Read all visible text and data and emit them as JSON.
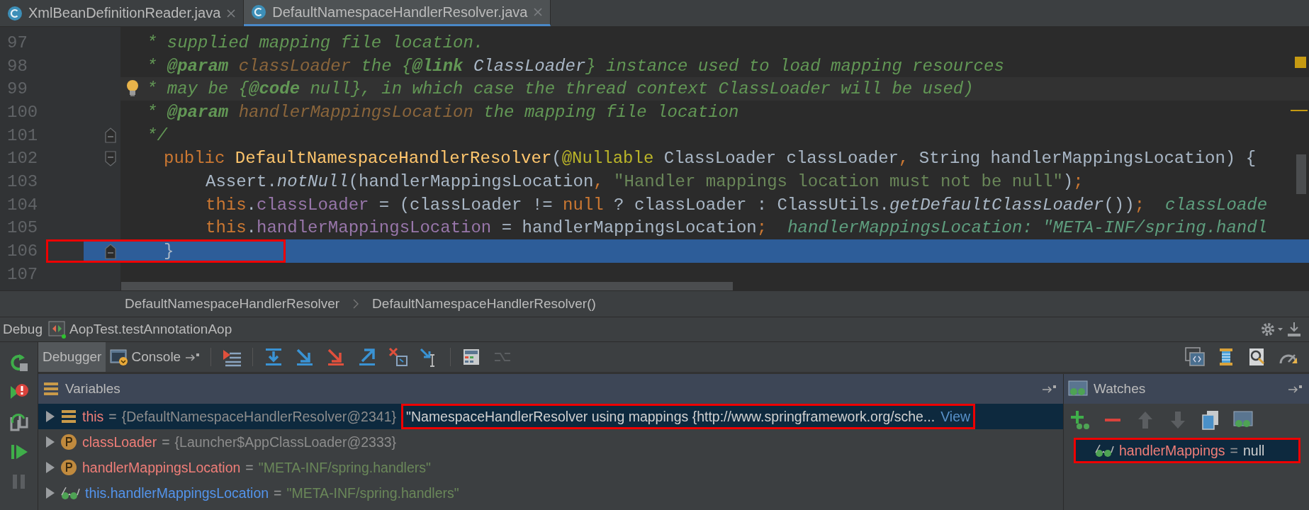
{
  "tabs": [
    {
      "label": "XmlBeanDefinitionReader.java",
      "selected": false
    },
    {
      "label": "DefaultNamespaceHandlerResolver.java",
      "selected": true
    }
  ],
  "editor": {
    "lines": [
      {
        "number": "97",
        "kind": "comment",
        "current": false,
        "execution": false,
        "annotated": false,
        "tokens": [
          {
            "t": "* supplied mapping file location.",
            "kind": "comment"
          }
        ]
      },
      {
        "number": "98",
        "kind": "comment",
        "current": false,
        "execution": false,
        "annotated": false,
        "tokens": [
          {
            "t": "* ",
            "kind": "comment"
          },
          {
            "t": "@param",
            "kind": "tag"
          },
          {
            "t": " classLoader",
            "kind": "param"
          },
          {
            "t": " the {",
            "kind": "comment"
          },
          {
            "t": "@link",
            "kind": "tag"
          },
          {
            "t": " ClassLoader",
            "kind": "link"
          },
          {
            "t": "} instance used to load mapping resources",
            "kind": "comment"
          }
        ]
      },
      {
        "number": "99",
        "kind": "comment",
        "current": true,
        "execution": false,
        "annotated": false,
        "tokens": [
          {
            "t": "* may be {",
            "kind": "comment"
          },
          {
            "t": "@code",
            "kind": "tag"
          },
          {
            "t": " null}, in which case the thread context ClassLoader will be used)",
            "kind": "comment"
          }
        ]
      },
      {
        "number": "100",
        "kind": "comment",
        "current": false,
        "execution": false,
        "annotated": false,
        "tokens": [
          {
            "t": "* ",
            "kind": "comment"
          },
          {
            "t": "@param",
            "kind": "tag"
          },
          {
            "t": " handlerMappingsLocation",
            "kind": "param"
          },
          {
            "t": " the mapping file location",
            "kind": "comment"
          }
        ]
      },
      {
        "number": "101",
        "kind": "comment",
        "fold_start": false,
        "fold_end": true,
        "current": false,
        "execution": false,
        "annotated": false,
        "tokens": [
          {
            "t": "*/",
            "kind": "comment"
          }
        ]
      },
      {
        "number": "102",
        "kind": "signature",
        "fold_start": true,
        "fold_end": false,
        "current": false,
        "execution": false,
        "annotated": false,
        "tokens": [
          {
            "t": "public",
            "kind": "keyword"
          },
          {
            "t": " DefaultNamespaceHandlerResolver",
            "kind": "function"
          },
          {
            "t": "(",
            "kind": "plain"
          },
          {
            "t": "@Nullable",
            "kind": "annotation"
          },
          {
            "t": " ClassLoader classLoader",
            "kind": "plain"
          },
          {
            "t": ",",
            "kind": "keyword"
          },
          {
            "t": " String handlerMappingsLocation) {",
            "kind": "plain"
          }
        ]
      },
      {
        "number": "103",
        "kind": "body",
        "current": false,
        "execution": false,
        "annotated": false,
        "tokens": [
          {
            "t": "Assert.",
            "kind": "plain"
          },
          {
            "t": "notNull",
            "kind": "static"
          },
          {
            "t": "(handlerMappingsLocation",
            "kind": "plain"
          },
          {
            "t": ",",
            "kind": "keyword"
          },
          {
            "t": " \"Handler mappings location must not be null\"",
            "kind": "string"
          },
          {
            "t": ")",
            "kind": "plain"
          },
          {
            "t": ";",
            "kind": "keyword"
          }
        ]
      },
      {
        "number": "104",
        "kind": "body",
        "current": false,
        "execution": false,
        "annotated": false,
        "tokens": [
          {
            "t": "this",
            "kind": "keyword"
          },
          {
            "t": ".",
            "kind": "plain"
          },
          {
            "t": "classLoader",
            "kind": "field"
          },
          {
            "t": " = (classLoader != ",
            "kind": "plain"
          },
          {
            "t": "null",
            "kind": "keyword"
          },
          {
            "t": " ? classLoader : ClassUtils.",
            "kind": "plain"
          },
          {
            "t": "getDefaultClassLoader",
            "kind": "static"
          },
          {
            "t": "())",
            "kind": "plain"
          },
          {
            "t": ";",
            "kind": "keyword"
          }
        ],
        "hint": "classLoade"
      },
      {
        "number": "105",
        "kind": "body",
        "current": false,
        "execution": false,
        "annotated": false,
        "tokens": [
          {
            "t": "this",
            "kind": "keyword"
          },
          {
            "t": ".",
            "kind": "plain"
          },
          {
            "t": "handlerMappingsLocation",
            "kind": "field"
          },
          {
            "t": " = handlerMappingsLocation",
            "kind": "plain"
          },
          {
            "t": ";",
            "kind": "keyword"
          }
        ],
        "hint": "handlerMappingsLocation: \"META-INF/spring.handl"
      },
      {
        "number": "106",
        "kind": "signature",
        "fold_start": false,
        "fold_end": true,
        "current": false,
        "execution": true,
        "annotated": true,
        "tokens": [
          {
            "t": "}",
            "kind": "plain"
          }
        ]
      },
      {
        "number": "107",
        "kind": "signature",
        "current": false,
        "execution": false,
        "annotated": false
      }
    ]
  },
  "breadcrumbs": [
    "DefaultNamespaceHandlerResolver",
    "DefaultNamespaceHandlerResolver()"
  ],
  "debug": {
    "title": "Debug",
    "config": "AopTest.testAnnotationAop",
    "tabs": [
      {
        "label": "Debugger",
        "selected": true
      },
      {
        "label": "Console",
        "selected": false
      }
    ],
    "variables": {
      "title": "Variables",
      "rows": [
        {
          "kind": "object",
          "name": "this",
          "op": "=",
          "value": "{DefaultNamespaceHandlerResolver@2341}",
          "string": "\"NamespaceHandlerResolver using mappings {http://www.springframework.org/sche...",
          "link": "View",
          "selected": true,
          "annotated": true
        },
        {
          "kind": "param",
          "name": "classLoader",
          "op": "=",
          "value": "{Launcher$AppClassLoader@2333}",
          "selected": false,
          "annotated": false
        },
        {
          "kind": "param",
          "name": "handlerMappingsLocation",
          "op": "=",
          "value": "\"META-INF/spring.handlers\"",
          "selected": false,
          "annotated": false
        },
        {
          "kind": "watch",
          "name": "this.handlerMappingsLocation",
          "op": "=",
          "value": "\"META-INF/spring.handlers\"",
          "selected": false,
          "annotated": false
        }
      ]
    },
    "watches": {
      "title": "Watches",
      "items": [
        {
          "name": "handlerMappings",
          "op": "=",
          "value": "null",
          "selected": true,
          "annotated": true
        }
      ]
    }
  }
}
